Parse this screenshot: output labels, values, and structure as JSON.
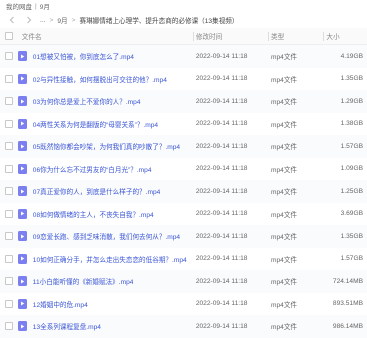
{
  "topbar": {
    "title": "我的网盘",
    "sep": "|",
    "trail": "9月"
  },
  "breadcrumb": {
    "items": [
      "...",
      "9月",
      "赛琳娜情绪上心理学、提升恋商的必修课（13集视频）"
    ],
    "separator": ">"
  },
  "columns": {
    "name": "文件名",
    "date": "修改时间",
    "type": "类型",
    "size": "大小"
  },
  "files": [
    {
      "name": "01想被又怕被，你到底怎么了.mp4",
      "date": "2022-09-14 11:18",
      "type": "mp4文件",
      "size": "4.19GB"
    },
    {
      "name": "02与异性接触，如何摆脱出可交往的他？.mp4",
      "date": "2022-09-14 11:18",
      "type": "mp4文件",
      "size": "1.35GB"
    },
    {
      "name": "03为何你总是爱上不爱你的人？.mp4",
      "date": "2022-09-14 11:18",
      "type": "mp4文件",
      "size": "1.29GB"
    },
    {
      "name": "04两性关系为何是翻版的“母婴关系”？.mp4",
      "date": "2022-09-14 11:18",
      "type": "mp4文件",
      "size": "1.38GB"
    },
    {
      "name": "05既然恼你都会吵架，为何我们真的吵散了？.mp4",
      "date": "2022-09-14 11:18",
      "type": "mp4文件",
      "size": "1.57GB"
    },
    {
      "name": "06你为什么忘不过男友的“白月光”？.mp4",
      "date": "2022-09-14 11:18",
      "type": "mp4文件",
      "size": "1.09GB"
    },
    {
      "name": "07真正爱你的人，到底是什么样子的？.mp4",
      "date": "2022-09-14 11:18",
      "type": "mp4文件",
      "size": "1.25GB"
    },
    {
      "name": "08如何做情绪的主人，不丧失自我？.mp4",
      "date": "2022-09-14 11:18",
      "type": "mp4文件",
      "size": "3.69GB"
    },
    {
      "name": "09恋爱长跑、感到乏味消散，我们何去何从？.mp4",
      "date": "2022-09-14 11:18",
      "type": "mp4文件",
      "size": "1.35GB"
    },
    {
      "name": "10如何正确分手，并怎么走出失恋恋的低谷期？.mp4",
      "date": "2022-09-14 11:18",
      "type": "mp4文件",
      "size": "1.57GB"
    },
    {
      "name": "11小白能听懂的《新婚赋法》.mp4",
      "date": "2022-09-14 11:18",
      "type": "mp4文件",
      "size": "724.14MB"
    },
    {
      "name": "12婚姻中的危.mp4",
      "date": "2022-09-14 11:18",
      "type": "mp4文件",
      "size": "893.51MB"
    },
    {
      "name": "13全系列课程复盘.mp4",
      "date": "2022-09-14 11:18",
      "type": "mp4文件",
      "size": "986.14MB"
    }
  ],
  "colors": {
    "file_icon": "#7b7ff0",
    "file_name": "#3a55d6"
  },
  "icons": {
    "back": "arrow-left-icon",
    "forward": "arrow-right-icon",
    "file": "video-file-icon"
  }
}
